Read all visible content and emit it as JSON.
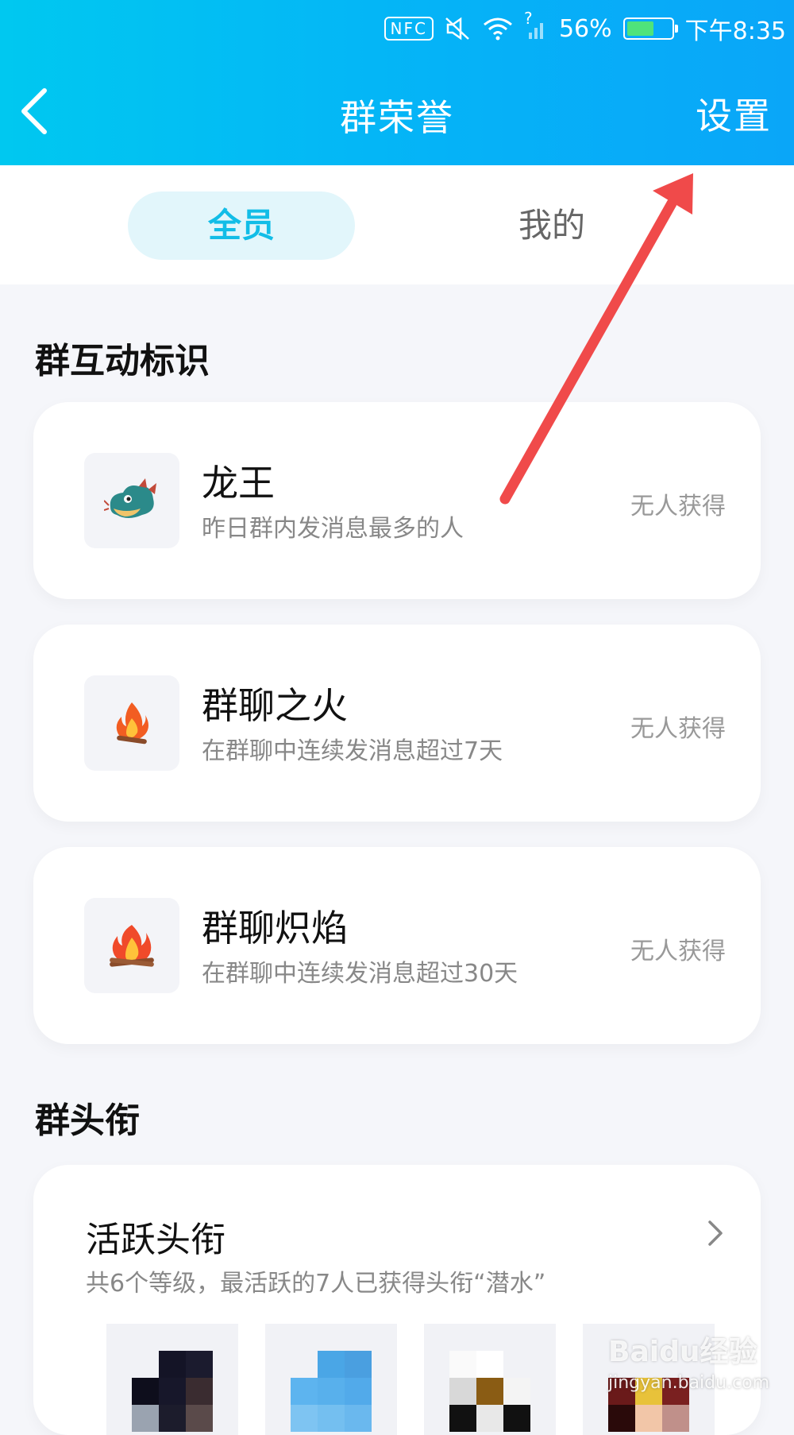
{
  "status_bar": {
    "nfc": "NFC",
    "signal_hint": "?",
    "battery": "56%",
    "battery_level": 0.56,
    "time": "下午8:35"
  },
  "header": {
    "title": "群荣誉",
    "settings_label": "设置",
    "back_icon": "chevron-left-icon"
  },
  "tabs": [
    {
      "label": "全员",
      "active": true
    },
    {
      "label": "我的",
      "active": false
    }
  ],
  "interaction_section": {
    "title": "群互动标识",
    "badges": [
      {
        "name": "龙王",
        "desc": "昨日群内发消息最多的人",
        "status": "无人获得",
        "icon": "dragon-icon"
      },
      {
        "name": "群聊之火",
        "desc": "在群聊中连续发消息超过7天",
        "status": "无人获得",
        "icon": "fire-icon"
      },
      {
        "name": "群聊炽焰",
        "desc": "在群聊中连续发消息超过30天",
        "status": "无人获得",
        "icon": "blazing-fire-icon"
      }
    ]
  },
  "title_section": {
    "title": "群头衔",
    "card": {
      "name": "活跃头衔",
      "desc": "共6个等级，最活跃的7人已获得头衔“潜水”",
      "chevron": "chevron-right-icon"
    }
  },
  "watermark": {
    "brand": "Baidu经验",
    "url": "jingyan.baidu.com"
  },
  "colors": {
    "header_start": "#00c8f0",
    "header_end": "#0aa6f8",
    "tab_active_bg": "#e2f6fb",
    "tab_active_text": "#12bde7",
    "annotation_arrow": "#f04a4a"
  }
}
